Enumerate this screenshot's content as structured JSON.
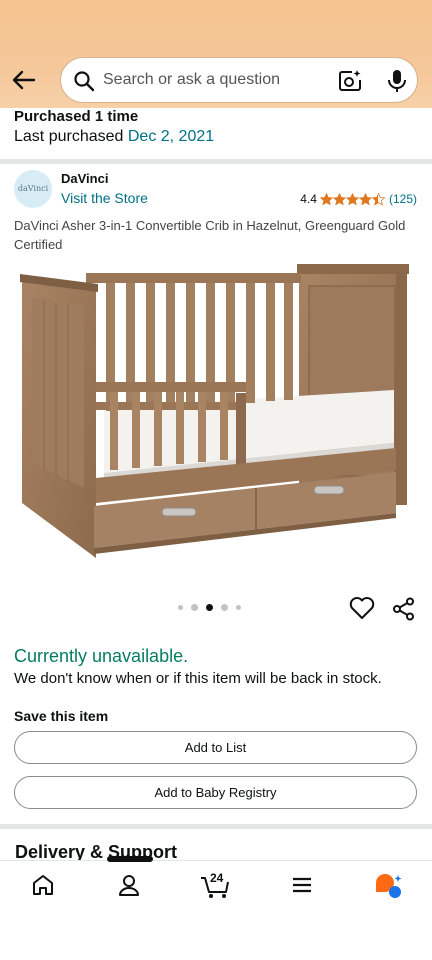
{
  "search": {
    "placeholder": "Search or ask a question"
  },
  "purchase": {
    "title": "Purchased 1 time",
    "last_label": "Last purchased ",
    "last_date": "Dec 2, 2021"
  },
  "seller": {
    "logo_text": "daVinci",
    "brand": "DaVinci",
    "visit": "Visit the Store",
    "rating": "4.4",
    "stars": 4.4,
    "reviews": "(125)"
  },
  "product": {
    "title": "DaVinci Asher 3-in-1 Convertible Crib in Hazelnut, Greenguard Gold Certified",
    "image_index": 3,
    "image_count": 5
  },
  "availability": {
    "status": "Currently unavailable.",
    "note": "We don't know when or if this item will be back in stock."
  },
  "save": {
    "label": "Save this item",
    "add_to_list": "Add to List",
    "add_to_registry": "Add to Baby Registry"
  },
  "delivery": {
    "heading": "Delivery & Support"
  },
  "nav": {
    "cart_count": "24"
  },
  "colors": {
    "link": "#007185",
    "available": "#067d62",
    "star": "#de7921",
    "header": "#f3c48e"
  }
}
